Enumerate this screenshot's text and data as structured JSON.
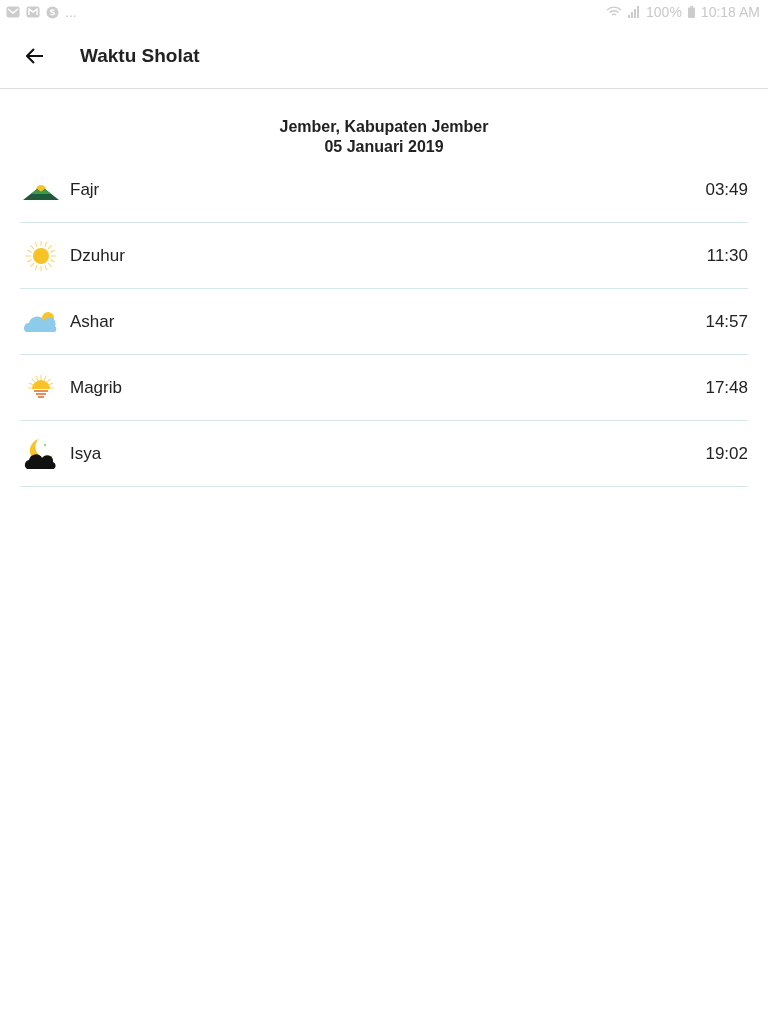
{
  "status_bar": {
    "more": "...",
    "battery": "100%",
    "time": "10:18 AM"
  },
  "app_bar": {
    "title": "Waktu Sholat"
  },
  "location": "Jember, Kabupaten Jember",
  "date": "05 Januari 2019",
  "prayers": [
    {
      "kind": "fajr",
      "name": "Fajr",
      "time": "03:49"
    },
    {
      "kind": "dzuhur",
      "name": "Dzuhur",
      "time": "11:30"
    },
    {
      "kind": "ashar",
      "name": "Ashar",
      "time": "14:57"
    },
    {
      "kind": "magrib",
      "name": "Magrib",
      "time": "17:48"
    },
    {
      "kind": "isya",
      "name": "Isya",
      "time": "19:02"
    }
  ]
}
